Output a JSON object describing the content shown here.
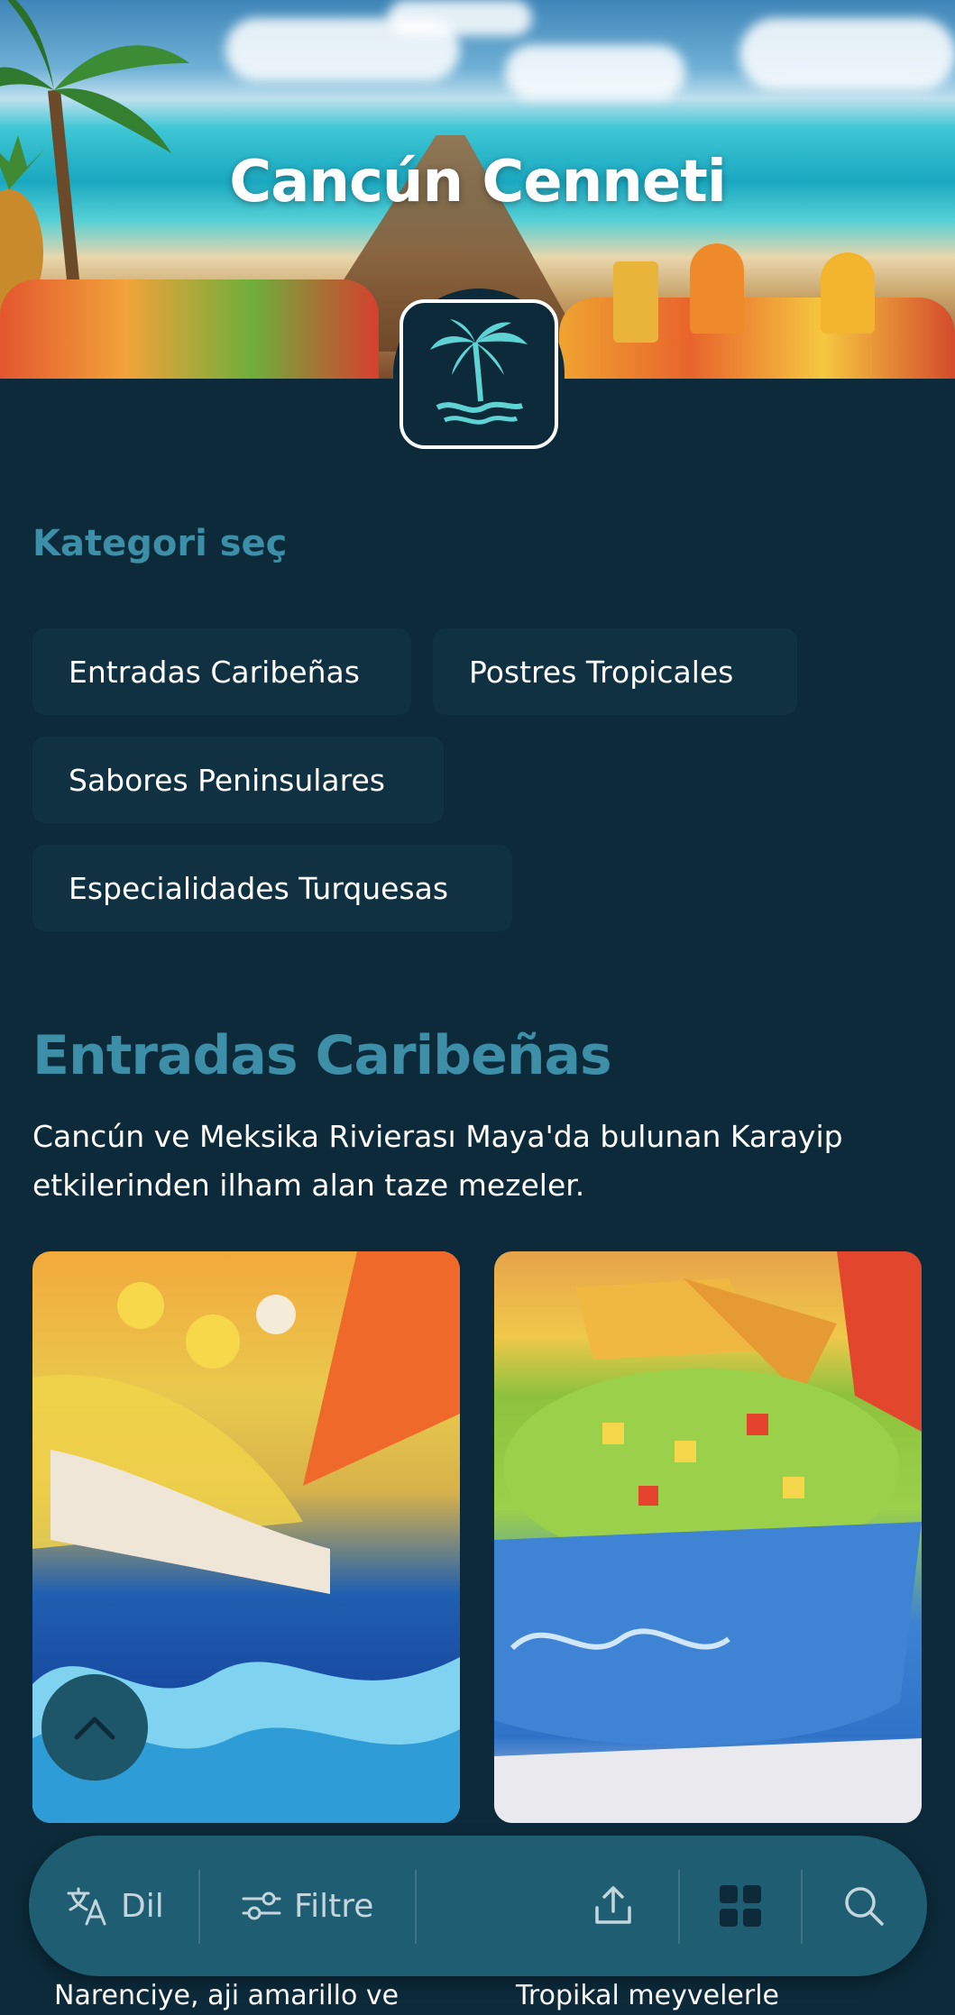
{
  "hero": {
    "title": "Cancún Cenneti"
  },
  "category": {
    "heading": "Kategori seç",
    "chips": [
      "Entradas Caribeñas",
      "Postres Tropicales",
      "Sabores Peninsulares",
      "Especialidades Turquesas"
    ]
  },
  "section": {
    "title": "Entradas Caribeñas",
    "description": "Cancún ve Meksika Rivierası Maya'da bulunan Karayip etkilerinden ilham alan taze mezeler."
  },
  "cards": [
    {
      "title": "Narenciye, aji amarillo ve"
    },
    {
      "title": "Tropikal meyvelerle"
    }
  ],
  "bottom_bar": {
    "language_label": "Dil",
    "filter_label": "Filtre"
  },
  "colors": {
    "background": "#0c2a3a",
    "accent": "#3d8ea7",
    "bar": "#1f5d72"
  }
}
